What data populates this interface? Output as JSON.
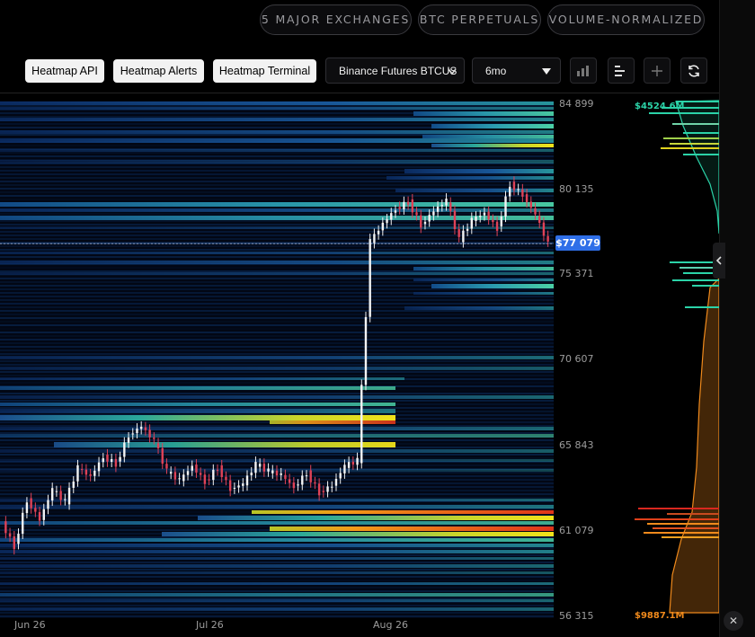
{
  "top_pills": [
    "5 MAJOR EXCHANGES",
    "BTC PERPETUALS",
    "VOLUME-NORMALIZED"
  ],
  "toolbar": {
    "buttons": [
      "Heatmap API",
      "Heatmap Alerts",
      "Heatmap Terminal"
    ],
    "exchange_select": "Binance Futures BTCUS",
    "range_select": "6mo",
    "icons": [
      "bar-chart-icon",
      "horizontal-bars-icon",
      "plus-icon",
      "refresh-icon"
    ]
  },
  "current_price": "$77 079",
  "profile_labels": {
    "top": "$4524.6M",
    "bottom": "$9887.1M"
  },
  "colors": {
    "ask_profile": "#2bd3a8",
    "bid_profile": "#f08a1c",
    "current_price_badge": "#2f6fe8"
  },
  "chart_data": {
    "type": "heatmap",
    "title": "",
    "xlabel": "",
    "ylabel": "",
    "x_ticks": [
      "Jun 26",
      "Jul 26",
      "Aug 26"
    ],
    "y_ticks": [
      "84 899",
      "80 135",
      "75 371",
      "70 607",
      "65 843",
      "61 079",
      "56 315"
    ],
    "ylim": [
      56315,
      84899
    ],
    "current_price": 77079,
    "price_path": [
      61500,
      60200,
      62800,
      61700,
      63400,
      62700,
      64600,
      64100,
      65200,
      64800,
      66400,
      66900,
      66100,
      64400,
      63900,
      64700,
      63800,
      64600,
      63400,
      63700,
      64800,
      64400,
      64200,
      63500,
      64300,
      63200,
      63600,
      64700,
      65000,
      77200,
      78200,
      79000,
      79400,
      78100,
      78900,
      79500,
      77300,
      78400,
      78800,
      77900,
      80400,
      79800,
      78700,
      77079
    ]
  }
}
